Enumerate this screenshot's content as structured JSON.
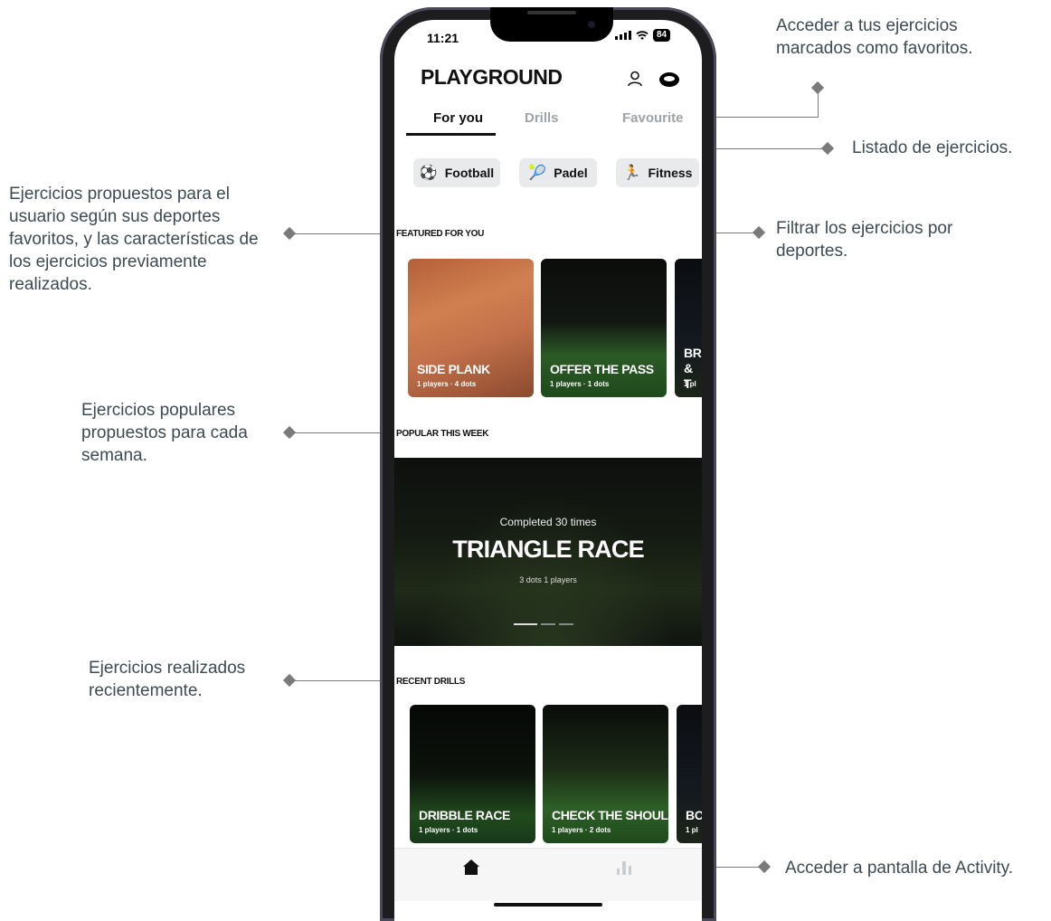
{
  "annotations": {
    "favourites": "Acceder a tus ejercicios marcados como favoritos.",
    "drills_list": "Listado de ejercicios.",
    "featured": "Ejercicios propuestos para el usuario según sus deportes favoritos, y las características de los ejercicios previamente realizados.",
    "filter": "Filtrar los ejercicios por deportes.",
    "popular": "Ejercicios populares propuestos para cada semana.",
    "recent": "Ejercicios realizados recientemente.",
    "activity": "Acceder a pantalla de Activity."
  },
  "status_bar": {
    "time": "11:21",
    "battery": "84"
  },
  "app": {
    "title": "PLAYGROUND"
  },
  "tabs": [
    {
      "label": "For you",
      "active": true
    },
    {
      "label": "Drills",
      "active": false
    },
    {
      "label": "Favourite",
      "active": false
    }
  ],
  "filters": [
    {
      "label": "Football",
      "icon": "football-player-icon"
    },
    {
      "label": "Padel",
      "icon": "padel-player-icon"
    },
    {
      "label": "Fitness",
      "icon": "running-icon"
    }
  ],
  "featured": {
    "heading": "FEATURED FOR YOU",
    "cards": [
      {
        "title": "SIDE PLANK",
        "meta": "1 players · 4 dots"
      },
      {
        "title": "OFFER THE PASS",
        "meta": "1 players · 1 dots"
      },
      {
        "title": "BR & T",
        "meta": "1 pl"
      }
    ]
  },
  "popular": {
    "heading": "POPULAR THIS WEEK",
    "completed": "Completed 30 times",
    "title": "TRIANGLE RACE",
    "meta": "3 dots  1 players"
  },
  "recent": {
    "heading": "RECENT DRILLS",
    "cards": [
      {
        "title": "DRIBBLE RACE",
        "meta": "1 players · 1 dots"
      },
      {
        "title": "CHECK THE SHOULDER",
        "meta": "1 players · 2 dots"
      },
      {
        "title": "BO",
        "meta": "1 pl"
      }
    ]
  },
  "nav": {
    "home_icon": "home-icon",
    "activity_icon": "bar-chart-icon"
  }
}
